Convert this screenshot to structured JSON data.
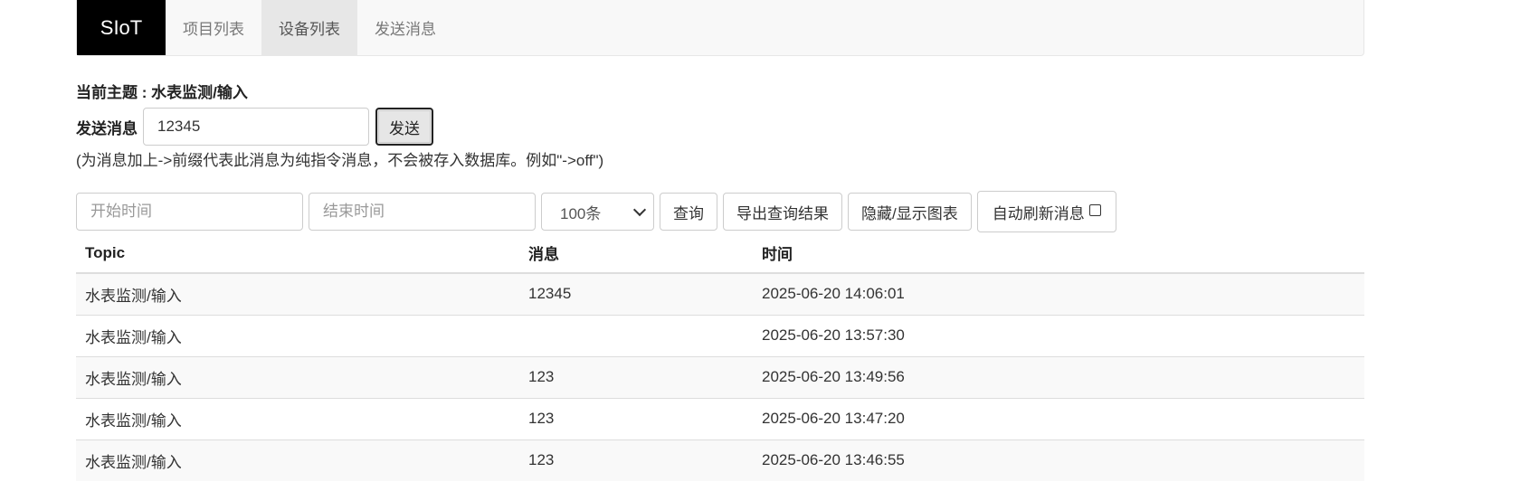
{
  "navbar": {
    "brand": "SIoT",
    "items": [
      {
        "label": "项目列表",
        "active": false
      },
      {
        "label": "设备列表",
        "active": true
      },
      {
        "label": "发送消息",
        "active": false
      }
    ]
  },
  "topic": {
    "label": "当前主题 : 水表监测/输入"
  },
  "send": {
    "label": "发送消息",
    "value": "12345",
    "button": "发送",
    "hint": "(为消息加上->前缀代表此消息为纯指令消息，不会被存入数据库。例如\"->off\")"
  },
  "filters": {
    "start_placeholder": "开始时间",
    "end_placeholder": "结束时间",
    "limit_selected": "100条",
    "query_button": "查询",
    "export_button": "导出查询结果",
    "toggle_chart_button": "隐藏/显示图表",
    "auto_refresh_label": "自动刷新消息",
    "auto_refresh_checked": false
  },
  "table": {
    "headers": [
      "Topic",
      "消息",
      "时间"
    ],
    "rows": [
      {
        "topic": "水表监测/输入",
        "message": "12345",
        "time": "2025-06-20 14:06:01"
      },
      {
        "topic": "水表监测/输入",
        "message": "",
        "time": "2025-06-20 13:57:30"
      },
      {
        "topic": "水表监测/输入",
        "message": "123",
        "time": "2025-06-20 13:49:56"
      },
      {
        "topic": "水表监测/输入",
        "message": "123",
        "time": "2025-06-20 13:47:20"
      },
      {
        "topic": "水表监测/输入",
        "message": "123",
        "time": "2025-06-20 13:46:55"
      }
    ]
  },
  "colors": {
    "brand_bg": "#000000",
    "navbar_bg": "#f8f8f8",
    "active_tab_bg": "#e7e7e7",
    "striped_row_bg": "#f9f9f9"
  }
}
